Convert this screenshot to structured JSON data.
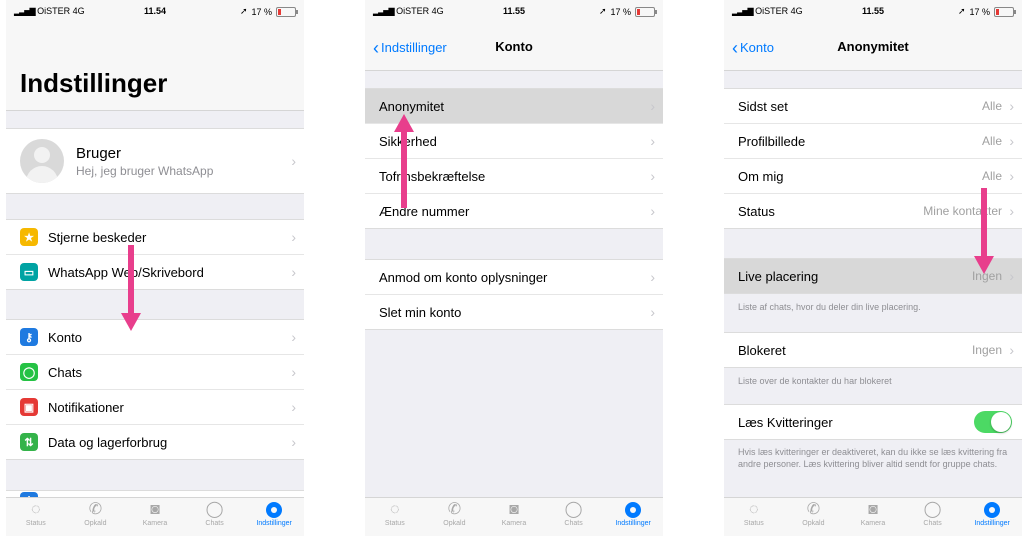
{
  "statusbar": {
    "carrier": "OiSTER 4G",
    "battery": "17 %",
    "time1": "11.54",
    "time2": "11.55",
    "time3": "11.55"
  },
  "screen1": {
    "title": "Indstillinger",
    "profile": {
      "name": "Bruger",
      "status": "Hej, jeg bruger WhatsApp"
    },
    "items": [
      {
        "label": "Stjerne beskeder",
        "icon": "star-icon",
        "color": "#f6b800",
        "glyph": "★"
      },
      {
        "label": "WhatsApp Web/Skrivebord",
        "icon": "laptop-icon",
        "color": "#00a3a3",
        "glyph": "▭"
      },
      {
        "label": "Konto",
        "icon": "key-icon",
        "color": "#1f7ae0",
        "glyph": "⚷"
      },
      {
        "label": "Chats",
        "icon": "whatsapp-icon",
        "color": "#25c244",
        "glyph": "◯"
      },
      {
        "label": "Notifikationer",
        "icon": "notification-icon",
        "color": "#e53935",
        "glyph": "▣"
      },
      {
        "label": "Data og lagerforbrug",
        "icon": "data-icon",
        "color": "#34b34a",
        "glyph": "⇅"
      }
    ]
  },
  "screen2": {
    "back_label": "Indstillinger",
    "title": "Konto",
    "group1": [
      "Anonymitet",
      "Sikkerhed",
      "Tofrinsbekræftelse",
      "Ændre nummer"
    ],
    "group2": [
      "Anmod om konto oplysninger",
      "Slet min konto"
    ]
  },
  "screen3": {
    "back_label": "Konto",
    "title": "Anonymitet",
    "rows": [
      {
        "label": "Sidst set",
        "value": "Alle"
      },
      {
        "label": "Profilbillede",
        "value": "Alle"
      },
      {
        "label": "Om mig",
        "value": "Alle"
      },
      {
        "label": "Status",
        "value": "Mine kontakter"
      }
    ],
    "live": {
      "label": "Live placering",
      "value": "Ingen",
      "note": "Liste af chats, hvor du deler din live placering."
    },
    "blocked": {
      "label": "Blokeret",
      "value": "Ingen",
      "note": "Liste over de kontakter du har blokeret"
    },
    "receipts": {
      "label": "Læs Kvitteringer",
      "enabled": true,
      "note": "Hvis læs kvitteringer er deaktiveret, kan du ikke se læs kvittering fra andre personer. Læs kvittering bliver altid sendt for gruppe chats."
    }
  },
  "tabs": [
    {
      "label": "Status",
      "icon": "status-icon"
    },
    {
      "label": "Opkald",
      "icon": "phone-icon"
    },
    {
      "label": "Kamera",
      "icon": "camera-icon"
    },
    {
      "label": "Chats",
      "icon": "chat-icon"
    },
    {
      "label": "Indstillinger",
      "icon": "settings-icon"
    }
  ],
  "colors": {
    "accent": "#007aff",
    "arrow": "#e83e8c",
    "toggle_on": "#4cd964"
  }
}
